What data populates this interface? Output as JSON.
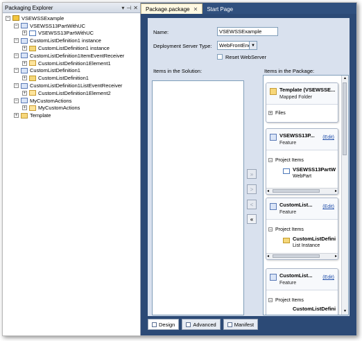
{
  "explorer": {
    "title": "Packaging Explorer",
    "controls": [
      "▾",
      "⊣",
      "✕"
    ],
    "tree": [
      {
        "label": "VSEWSSExample",
        "level": 0,
        "toggle": "−",
        "icon": "project-icon"
      },
      {
        "label": "VSEWSS13PartWithUC",
        "level": 1,
        "toggle": "−",
        "icon": "feature-icon"
      },
      {
        "label": "VSEWSS13PartWithUC",
        "level": 2,
        "toggle": "+",
        "icon": "webpart-icon"
      },
      {
        "label": "CustomListDefinition1 instance",
        "level": 1,
        "toggle": "−",
        "icon": "feature-icon"
      },
      {
        "label": "CustomListDefinition1 instance",
        "level": 2,
        "toggle": "+",
        "icon": "list-instance-icon"
      },
      {
        "label": "CustomListDefinition1ItemEventReceiver",
        "level": 1,
        "toggle": "−",
        "icon": "feature-icon"
      },
      {
        "label": "CustomListDefinition1Element1",
        "level": 2,
        "toggle": "+",
        "icon": "event-receiver-icon"
      },
      {
        "label": "CustomListDefinition1",
        "level": 1,
        "toggle": "−",
        "icon": "feature-icon"
      },
      {
        "label": "CustomListDefinition1",
        "level": 2,
        "toggle": "+",
        "icon": "list-definition-icon"
      },
      {
        "label": "CustomListDefinition1ListEventReceiver",
        "level": 1,
        "toggle": "−",
        "icon": "feature-icon"
      },
      {
        "label": "CustomListDefinition1Element2",
        "level": 2,
        "toggle": "+",
        "icon": "event-receiver-icon"
      },
      {
        "label": "MyCustomActions",
        "level": 1,
        "toggle": "−",
        "icon": "feature-icon"
      },
      {
        "label": "MyCustomActions",
        "level": 2,
        "toggle": "+",
        "icon": "custom-action-icon"
      },
      {
        "label": "Template",
        "level": 1,
        "toggle": "+",
        "icon": "folder-icon"
      }
    ]
  },
  "tabs": [
    {
      "label": "Package.package",
      "close": "✕",
      "active": true
    },
    {
      "label": "Start Page",
      "active": false
    }
  ],
  "form": {
    "name_label": "Name:",
    "name_value": "VSEWSSExample",
    "server_label": "Deployment Server Type:",
    "server_value": "WebFrontEnd",
    "server_arrow": "▼",
    "reset_label": "Reset WebServer",
    "solution_label": "Items in the Solution:",
    "package_label": "Items in the Package:"
  },
  "move_buttons": [
    {
      "label": "»",
      "enabled": false
    },
    {
      "label": ">",
      "enabled": false
    },
    {
      "label": "<",
      "enabled": false
    },
    {
      "label": "«",
      "enabled": true
    }
  ],
  "package_cards": [
    {
      "title": "Template (VSEWSSE...",
      "subtitle": "Mapped Folder",
      "edit": "",
      "section": "Files",
      "section_toggle": "+",
      "items": []
    },
    {
      "title": "VSEWSS13P...",
      "subtitle": "Feature",
      "edit": "(Edit)",
      "section": "Project Items",
      "section_toggle": "−",
      "items": [
        {
          "name": "VSEWSS13PartW",
          "type": "WebPart"
        }
      ]
    },
    {
      "title": "CustomList...",
      "subtitle": "Feature",
      "edit": "(Edit)",
      "section": "Project Items",
      "section_toggle": "−",
      "items": [
        {
          "name": "CustomListDefini",
          "type": "List Instance"
        }
      ]
    },
    {
      "title": "CustomList...",
      "subtitle": "Feature",
      "edit": "(Edit)",
      "section": "Project Items",
      "section_toggle": "−",
      "items": [
        {
          "name": "CustomListDefini",
          "type": ""
        }
      ]
    }
  ],
  "scroll_arrows": {
    "left": "◂",
    "right": "▸",
    "up": "▴",
    "down": "▾"
  },
  "bottom_tabs": [
    {
      "label": "Design",
      "active": true
    },
    {
      "label": "Advanced",
      "active": false
    },
    {
      "label": "Manifest",
      "active": false
    }
  ],
  "colors": {
    "tab_bar": "#2c4a76",
    "designer_bg": "#d9e1ee",
    "link": "#1b4aa8"
  }
}
